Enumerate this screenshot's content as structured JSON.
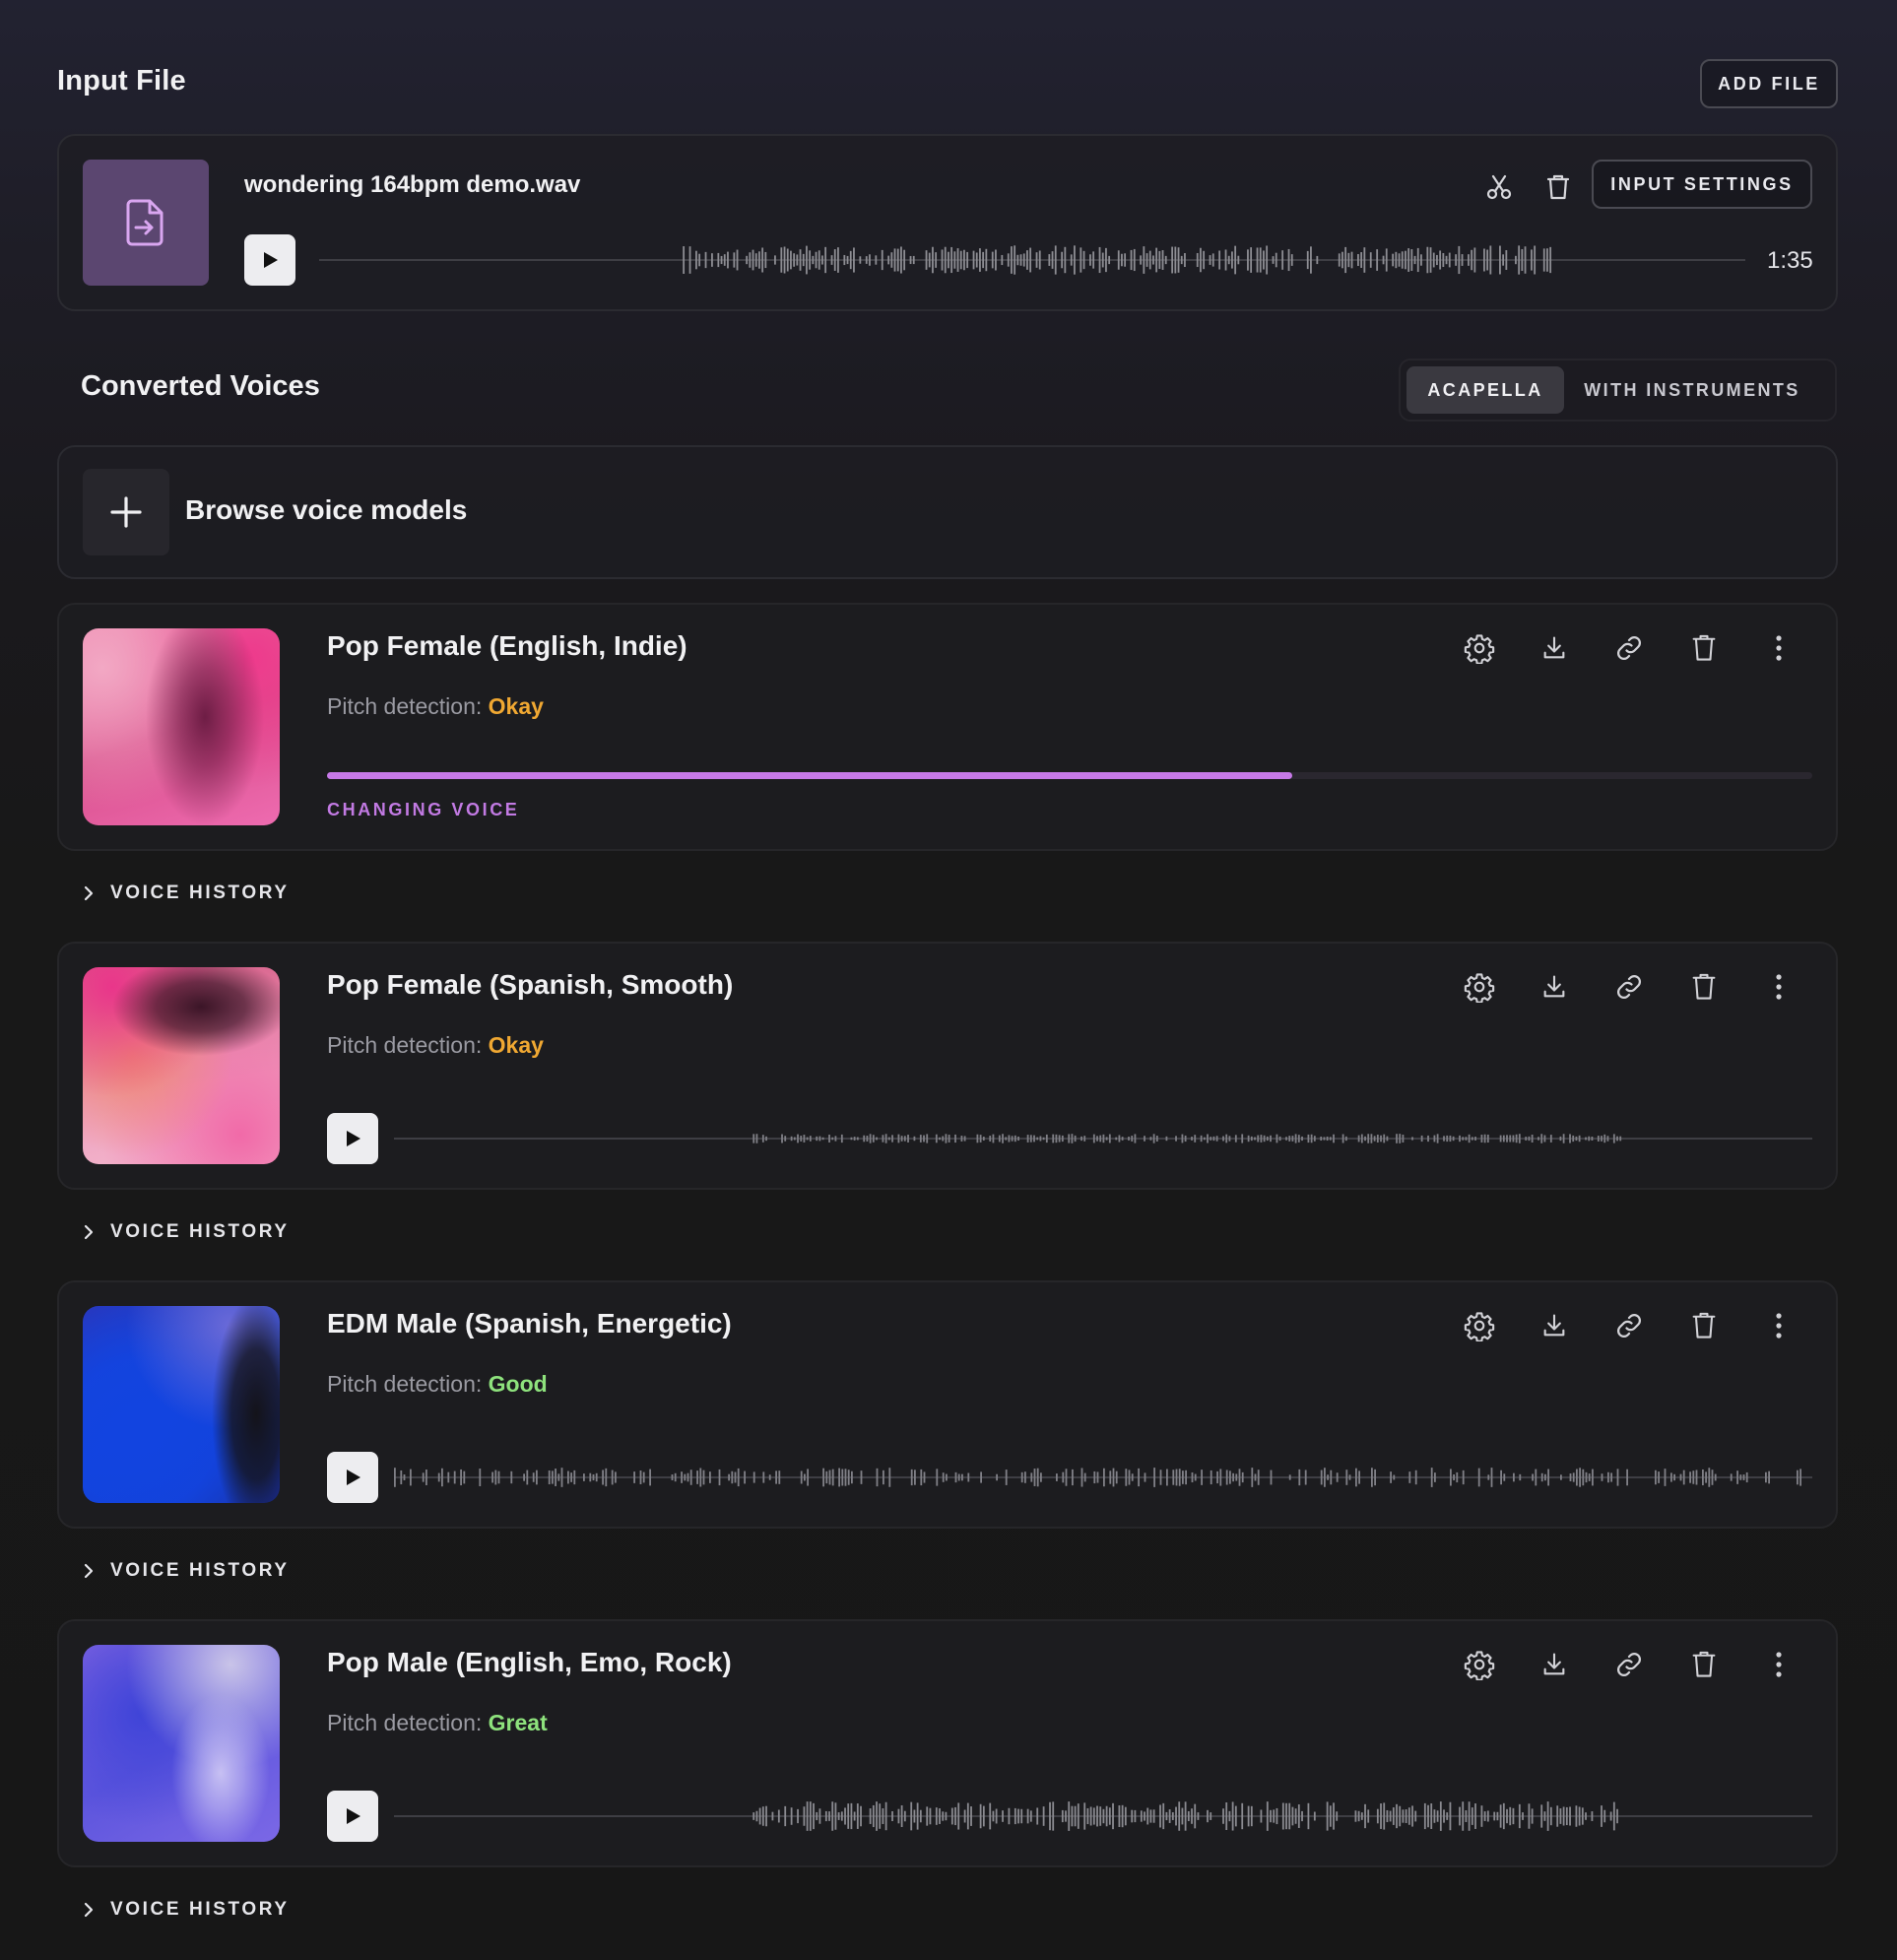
{
  "input_section": {
    "title": "Input File",
    "add_file_label": "ADD FILE",
    "file": {
      "name": "wondering 164bpm demo.wav",
      "duration": "1:35",
      "settings_label": "INPUT SETTINGS"
    }
  },
  "converted_section": {
    "title": "Converted Voices",
    "tabs": [
      {
        "label": "ACAPELLA",
        "active": true
      },
      {
        "label": "WITH INSTRUMENTS",
        "active": false
      }
    ],
    "browse_label": "Browse voice models"
  },
  "voices": [
    {
      "name": "Pop Female (English, Indie)",
      "pitch_label": "Pitch detection:",
      "pitch_value": "Okay",
      "pitch_color": "#f0a832",
      "status": "CHANGING VOICE",
      "progress": 0.65,
      "history_label": "VOICE HISTORY"
    },
    {
      "name": "Pop Female (Spanish, Smooth)",
      "pitch_label": "Pitch detection:",
      "pitch_value": "Okay",
      "pitch_color": "#f0a832",
      "history_label": "VOICE HISTORY"
    },
    {
      "name": "EDM Male (Spanish, Energetic)",
      "pitch_label": "Pitch detection:",
      "pitch_value": "Good",
      "pitch_color": "#8ee27d",
      "history_label": "VOICE HISTORY"
    },
    {
      "name": "Pop Male (English, Emo, Rock)",
      "pitch_label": "Pitch detection:",
      "pitch_value": "Great",
      "pitch_color": "#8ee27d",
      "history_label": "VOICE HISTORY"
    }
  ],
  "colors": {
    "accent": "#c779e8",
    "okay": "#f0a832",
    "good": "#8ee27d"
  },
  "icons": {
    "file_thumb": "file-import-icon",
    "trim": "scissors-icon",
    "delete": "trash-icon",
    "settings": "gear-icon",
    "download": "download-icon",
    "link": "link-icon",
    "more": "more-vertical-icon",
    "history": "chevron-right-icon",
    "add": "plus-icon",
    "play": "play-icon"
  }
}
